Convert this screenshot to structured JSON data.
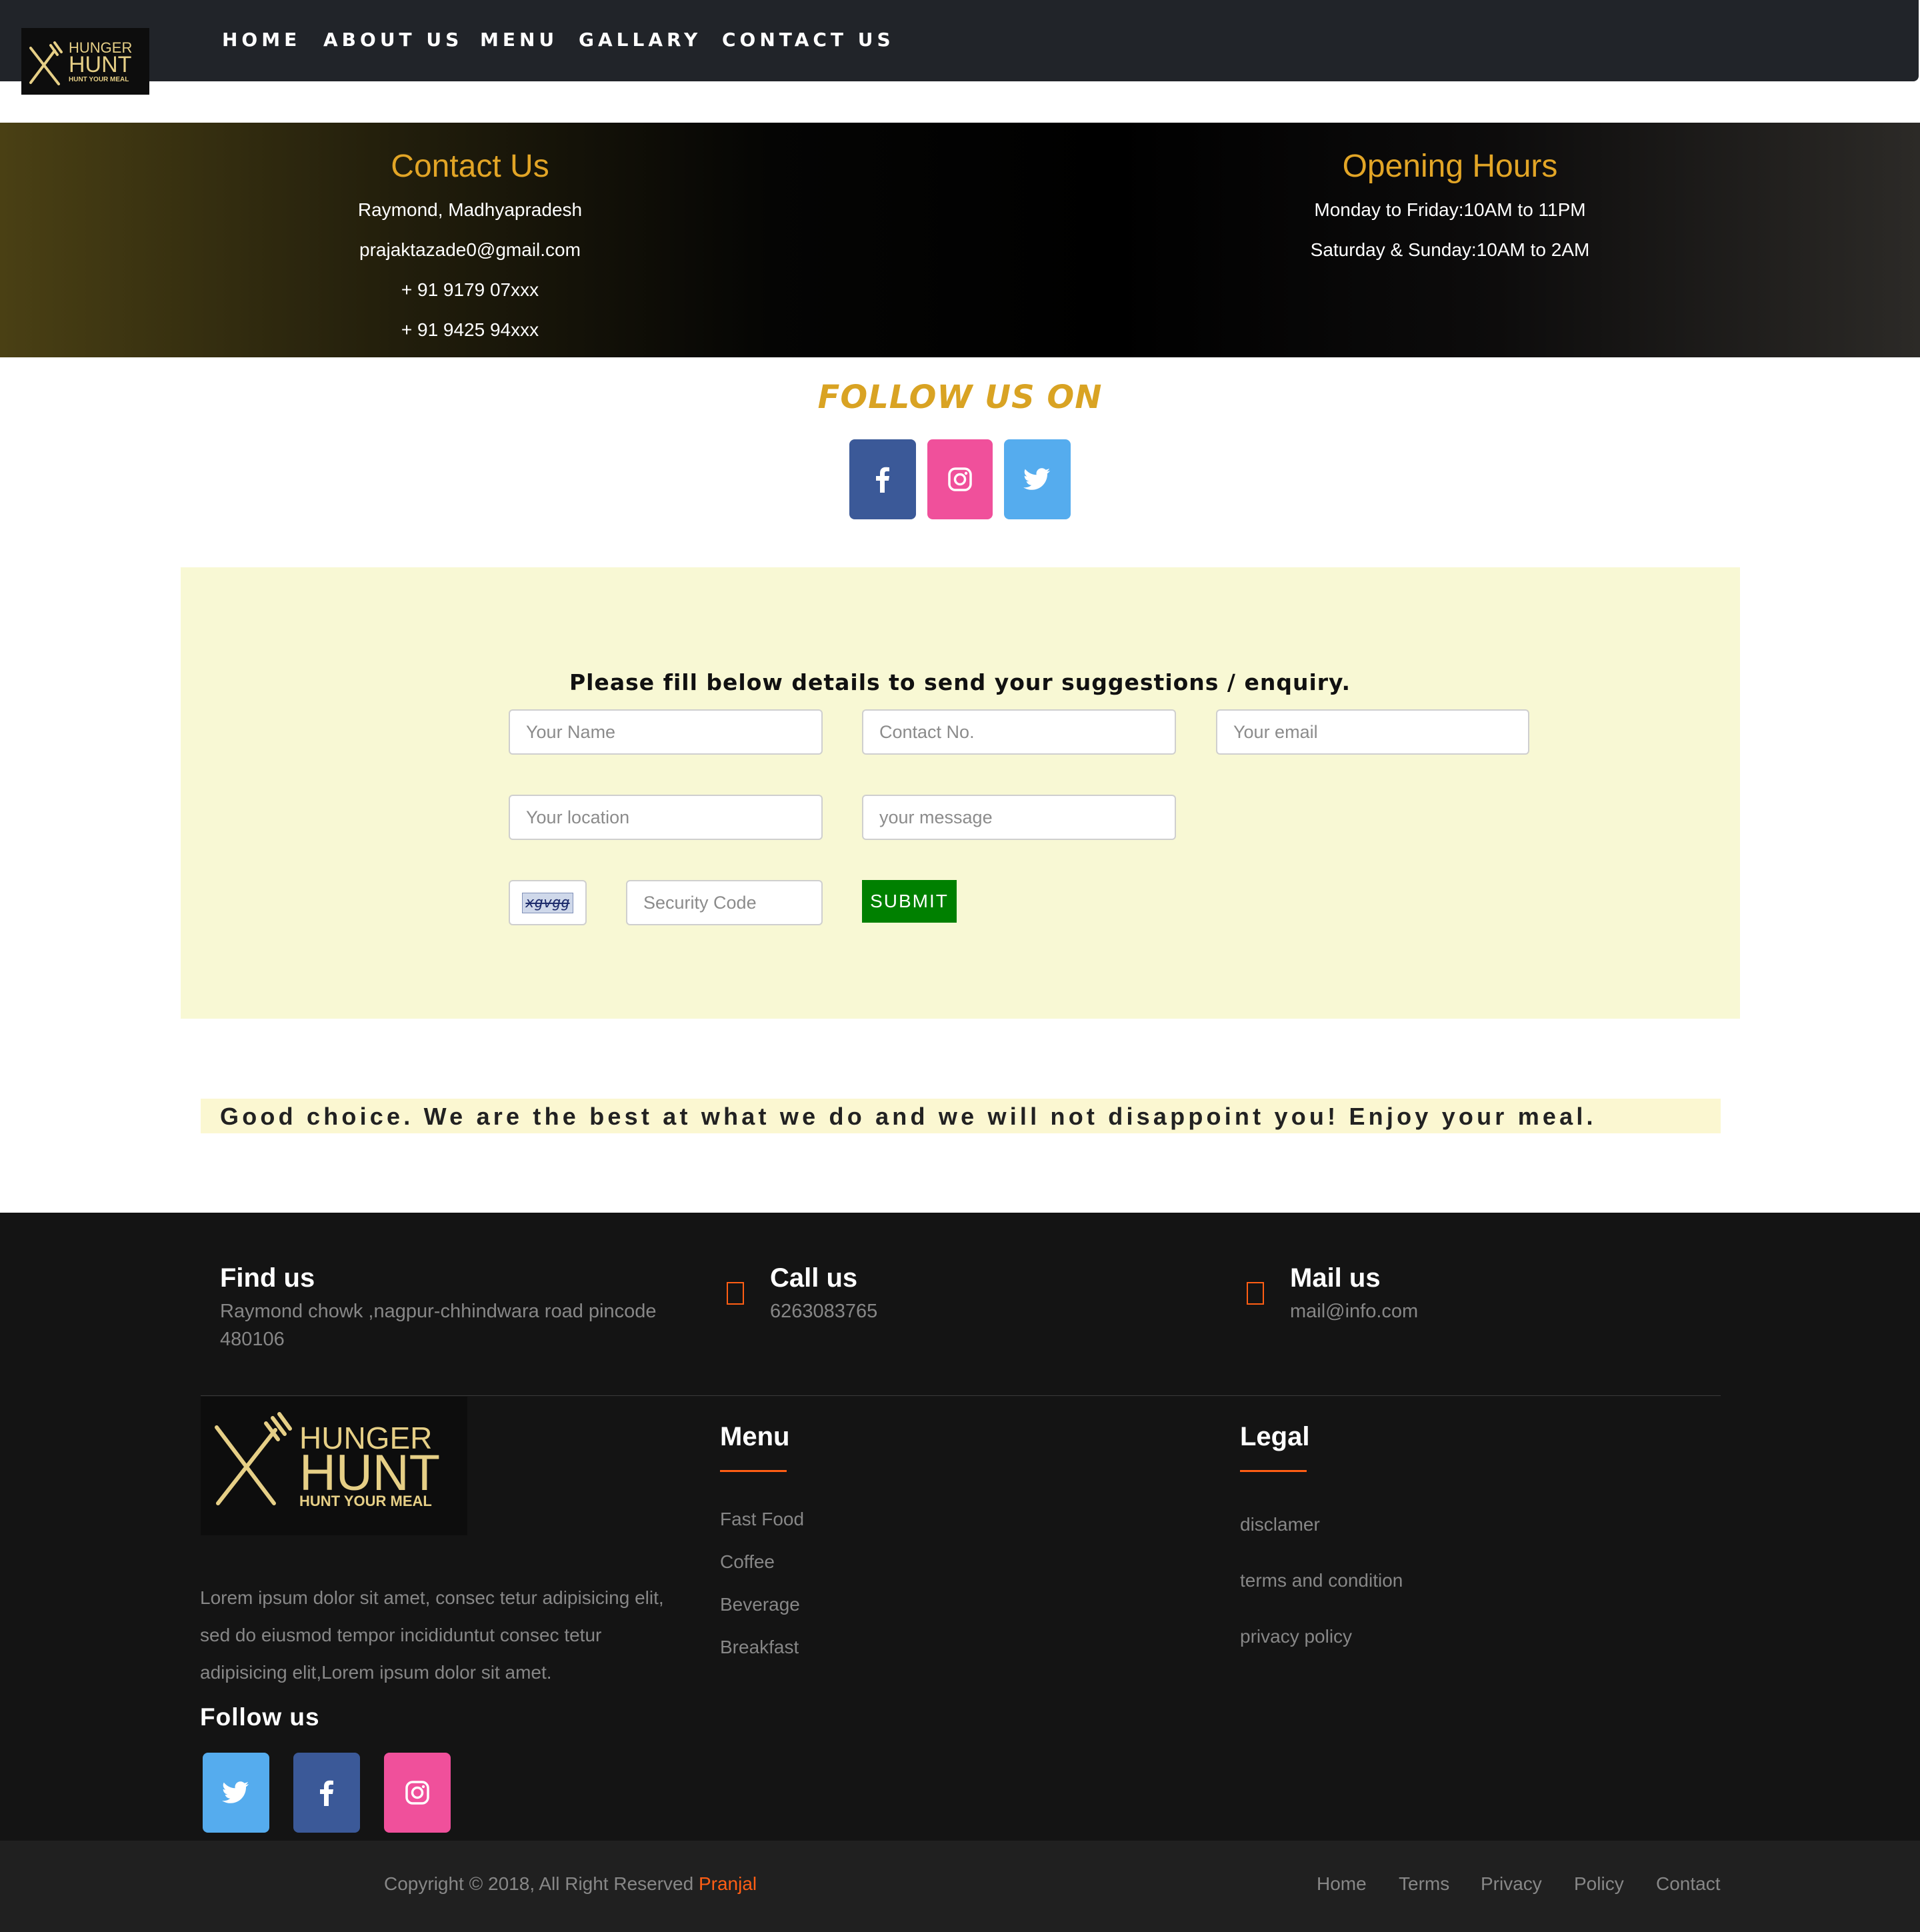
{
  "colors": {
    "accent_gold": "#e2a526",
    "accent_orange": "#ff5e14",
    "submit_green": "#008000",
    "facebook": "#3b5998",
    "instagram": "#f0509b",
    "twitter": "#55acee"
  },
  "brand": {
    "line1": "HUNGER",
    "line2": "HUNT",
    "tagline": "HUNT YOUR MEAL"
  },
  "nav": {
    "home": "HOME",
    "about": "ABOUT US",
    "menu": "MENU",
    "gallery": "GALLARY",
    "contact": "CONTACT US"
  },
  "contact": {
    "title": "Contact Us",
    "address": "Raymond, Madhyapradesh",
    "email": "prajaktazade0@gmail.com",
    "phone1": "+ 91 9179 07xxx",
    "phone2": "+ 91 9425 94xxx"
  },
  "hours": {
    "title": "Opening Hours",
    "weekdays": "Monday to Friday:10AM to 11PM",
    "weekend": "Saturday & Sunday:10AM to 2AM"
  },
  "follow": {
    "title": "FOLLOW US ON",
    "icons": [
      "facebook-icon",
      "instagram-icon",
      "twitter-icon"
    ]
  },
  "form": {
    "heading": "Please fill below details to send your suggestions / enquiry.",
    "name_placeholder": "Your Name",
    "contact_placeholder": "Contact No.",
    "email_placeholder": "Your email",
    "location_placeholder": "Your location",
    "message_placeholder": "your message",
    "captcha_text": "xgvgg",
    "security_placeholder": "Security Code",
    "submit_label": "SUBMIT"
  },
  "tagline": "Good choice. We are the best at what we do and we will not disappoint you! Enjoy your meal.",
  "footer": {
    "find": {
      "title": "Find us",
      "line1": "Raymond chowk ,nagpur-chhindwara road pincode",
      "line2": "480106"
    },
    "call": {
      "title": "Call us",
      "text": "6263083765"
    },
    "mail": {
      "title": "Mail us",
      "text": "mail@info.com"
    },
    "about": {
      "line1": "Lorem ipsum dolor sit amet, consec tetur adipisicing elit,",
      "line2": "sed do eiusmod tempor incididuntut consec tetur",
      "line3": "adipisicing elit,Lorem ipsum dolor sit amet."
    },
    "follow_title": "Follow us",
    "menu": {
      "title": "Menu",
      "items": [
        "Fast Food",
        "Coffee",
        "Beverage",
        "Breakfast"
      ]
    },
    "legal": {
      "title": "Legal",
      "items": [
        "disclamer",
        "terms and condition",
        "privacy policy"
      ]
    }
  },
  "bottom": {
    "copyright": "Copyright © 2018, All Right Reserved ",
    "author": "Pranjal",
    "links": [
      "Home",
      "Terms",
      "Privacy",
      "Policy",
      "Contact"
    ]
  }
}
